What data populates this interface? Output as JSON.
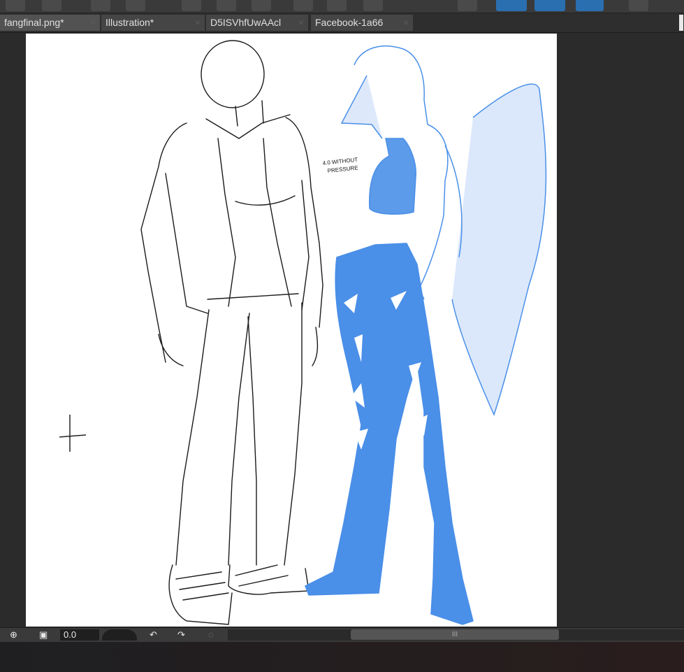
{
  "tabs": [
    {
      "label": "fangfinal.png*",
      "close": "×"
    },
    {
      "label": "Illustration*",
      "close": "×"
    },
    {
      "label": "D5ISVhfUwAAcl",
      "close": "×"
    },
    {
      "label": "Facebook-1a66",
      "close": "×"
    }
  ],
  "canvas": {
    "annotation_line1": "4.0 WITHOUT",
    "annotation_line2": "PRESSURE"
  },
  "statusbar": {
    "zoom_value": "0.0",
    "scroll_grip": "III"
  },
  "colors": {
    "accent_blue": "#2a6fb0",
    "figure_blue": "#4a8fe8"
  }
}
